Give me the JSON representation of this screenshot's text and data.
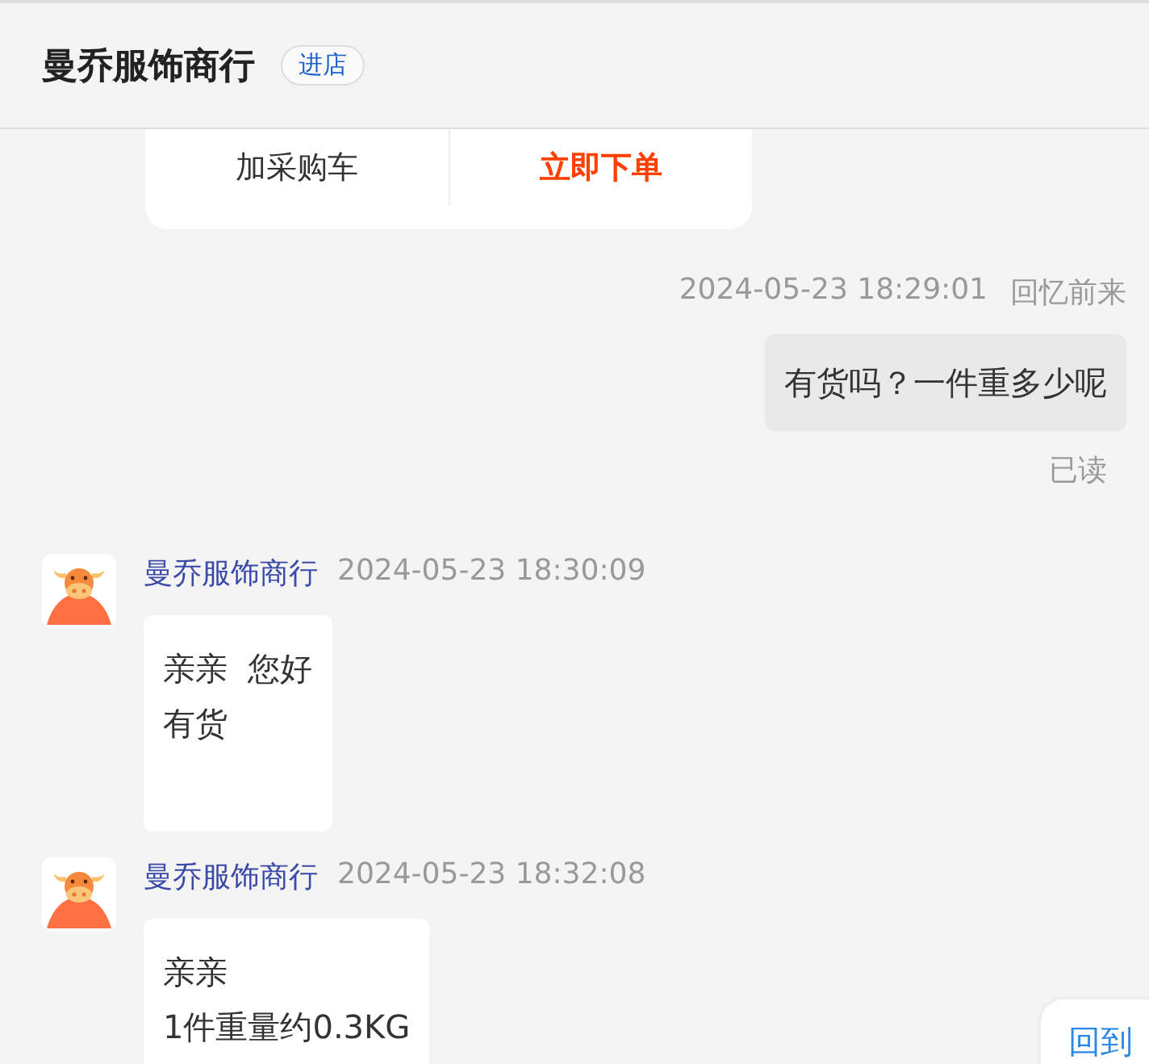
{
  "header": {
    "title": "曼乔服饰商行",
    "store_button": "进店"
  },
  "product_card_actions": [
    {
      "label": "加采购车",
      "kind": "secondary"
    },
    {
      "label": "立即下单",
      "kind": "primary"
    }
  ],
  "messages": [
    {
      "kind": "outgoing",
      "time": "2024-05-23 18:29:01",
      "sender": "回忆前来",
      "text": "有货吗？一件重多少呢",
      "status": "已读"
    },
    {
      "kind": "incoming",
      "sender": "曼乔服饰商行",
      "time": "2024-05-23 18:30:09",
      "lines": [
        "亲亲  您好",
        "有货"
      ]
    },
    {
      "kind": "incoming",
      "sender": "曼乔服饰商行",
      "time": "2024-05-23 18:32:08",
      "lines": [
        "亲亲",
        "1件重量约0.3KG"
      ]
    }
  ],
  "scroll_button": "回到"
}
